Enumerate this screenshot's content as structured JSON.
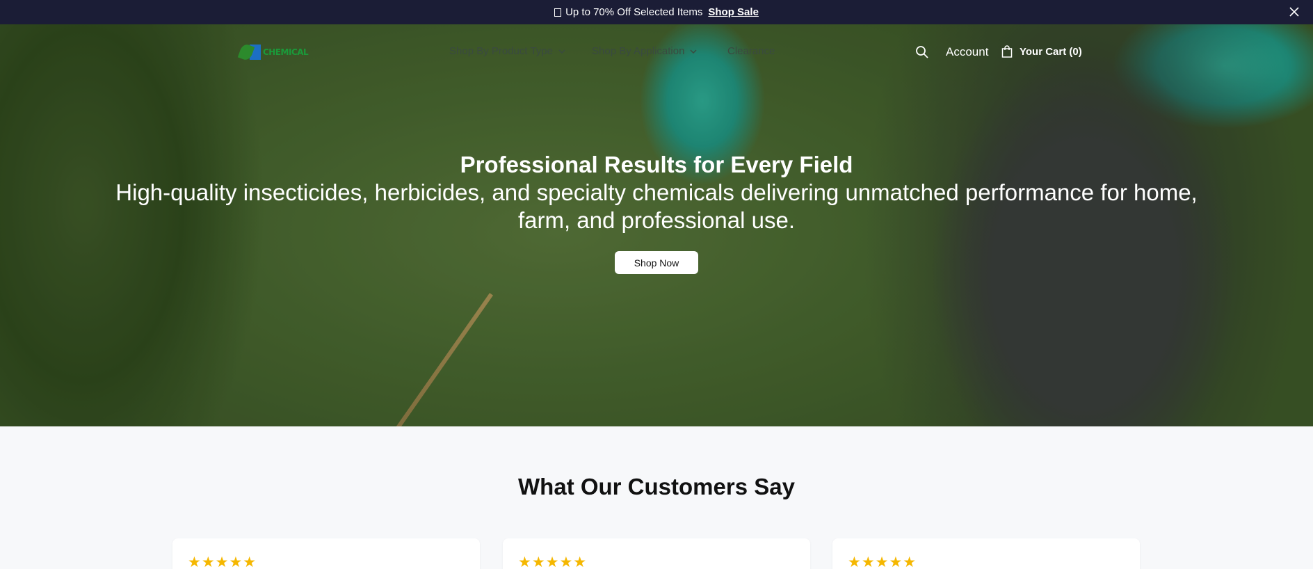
{
  "announcement": {
    "gift_icon": "gift-icon",
    "message": "Up to 70% Off Selected Items",
    "link_label": "Shop Sale",
    "close_icon": "close-icon"
  },
  "header": {
    "logo_text": "CHEMICAL",
    "nav": [
      {
        "label": "Shop By Product Type",
        "has_dropdown": true
      },
      {
        "label": "Shop By Application",
        "has_dropdown": true
      },
      {
        "label": "Clearance",
        "has_dropdown": false
      }
    ],
    "search_icon": "search-icon",
    "account_label": "Account",
    "cart_icon": "bag-icon",
    "cart_label": "Your Cart (0)"
  },
  "hero": {
    "title": "Professional Results for Every Field",
    "subtitle": "High-quality insecticides, herbicides, and specialty chemicals delivering unmatched performance for home, farm, and professional use.",
    "cta_label": "Shop Now"
  },
  "testimonials": {
    "title": "What Our Customers Say",
    "cards": [
      {
        "stars": "★★★★★"
      },
      {
        "stars": "★★★★★"
      },
      {
        "stars": "★★★★★"
      }
    ]
  },
  "colors": {
    "announcement_bg": "#1b1d36",
    "star": "#f5b700",
    "logo_green": "#1a9a3a",
    "logo_blue": "#1c6fc4"
  }
}
